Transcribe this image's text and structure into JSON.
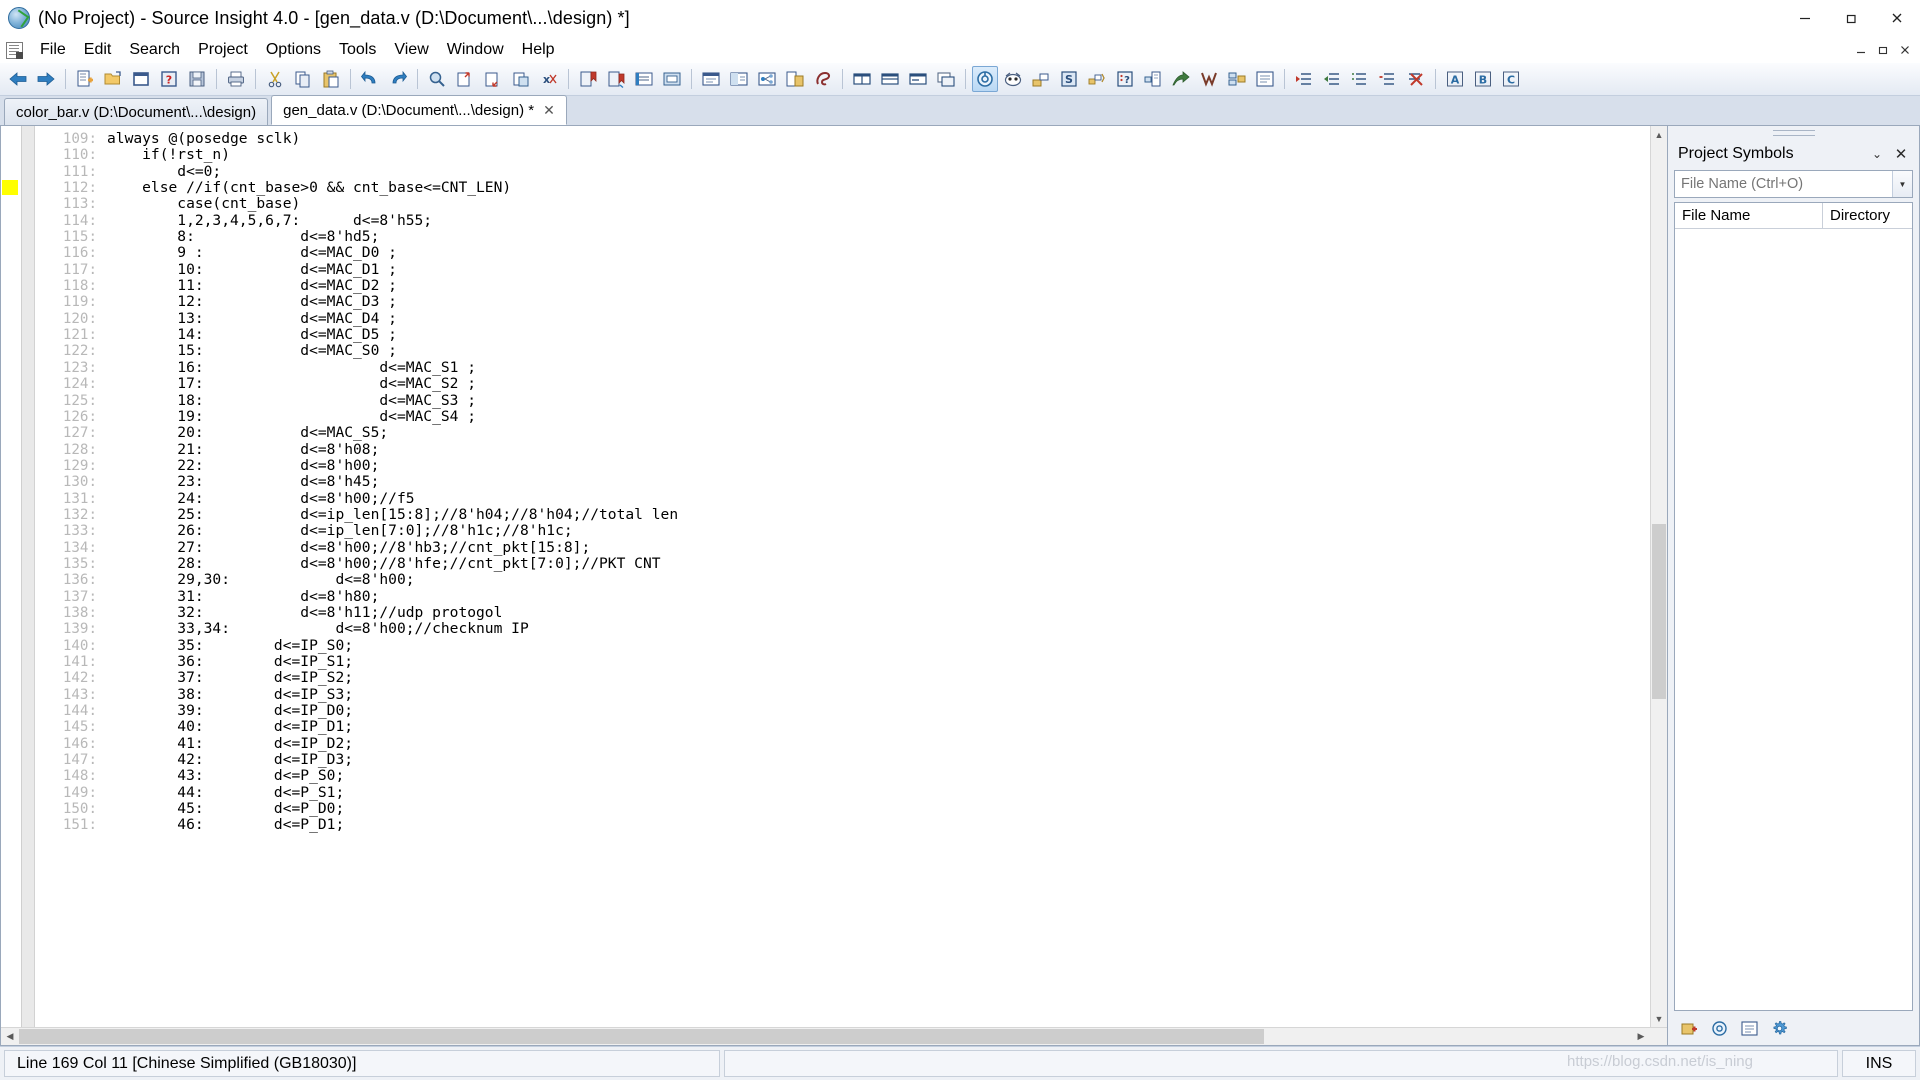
{
  "window": {
    "title": "(No Project) - Source Insight 4.0 - [gen_data.v (D:\\Document\\...\\design) *]",
    "app_icon": "source-insight-logo",
    "minimize": "─",
    "maximize": "❐",
    "close": "✕"
  },
  "menubar": {
    "doc_icon": "document-icon",
    "items": [
      {
        "label": "File"
      },
      {
        "label": "Edit"
      },
      {
        "label": "Search"
      },
      {
        "label": "Project"
      },
      {
        "label": "Options"
      },
      {
        "label": "Tools"
      },
      {
        "label": "View"
      },
      {
        "label": "Window"
      },
      {
        "label": "Help"
      }
    ],
    "mdi_minimize": "─",
    "mdi_restore": "❐",
    "mdi_close": "✕"
  },
  "toolbar": {
    "groups": [
      {
        "buttons": [
          {
            "name": "back-icon",
            "glyph": "back"
          },
          {
            "name": "forward-icon",
            "glyph": "forward"
          }
        ]
      },
      {
        "buttons": [
          {
            "name": "new-file-icon",
            "glyph": "newfile"
          },
          {
            "name": "open-file-icon",
            "glyph": "openfile"
          },
          {
            "name": "close-file-icon",
            "glyph": "closefile"
          },
          {
            "name": "file-properties-icon",
            "glyph": "fileprops"
          },
          {
            "name": "save-icon",
            "glyph": "save"
          }
        ]
      },
      {
        "buttons": [
          {
            "name": "print-icon",
            "glyph": "print"
          }
        ]
      },
      {
        "buttons": [
          {
            "name": "cut-icon",
            "glyph": "cut"
          },
          {
            "name": "copy-icon",
            "glyph": "copy"
          },
          {
            "name": "paste-icon",
            "glyph": "paste"
          }
        ]
      },
      {
        "buttons": [
          {
            "name": "undo-icon",
            "glyph": "undo"
          },
          {
            "name": "redo-icon",
            "glyph": "redo"
          }
        ]
      },
      {
        "buttons": [
          {
            "name": "search-icon",
            "glyph": "search"
          },
          {
            "name": "search-files-icon",
            "glyph": "searchfiles"
          },
          {
            "name": "search-backward-icon",
            "glyph": "searchback"
          },
          {
            "name": "replace-icon",
            "glyph": "replace"
          },
          {
            "name": "search-clear-icon",
            "glyph": "searchclear"
          }
        ]
      },
      {
        "buttons": [
          {
            "name": "bookmark-red-icon",
            "glyph": "bmred"
          },
          {
            "name": "bookmark-next-icon",
            "glyph": "bmnext"
          },
          {
            "name": "bookmark-list-icon",
            "glyph": "bmlist"
          },
          {
            "name": "bookmark-toggle-icon",
            "glyph": "bmtoggle"
          }
        ]
      },
      {
        "buttons": [
          {
            "name": "symbol-window-icon",
            "glyph": "symwin"
          },
          {
            "name": "context-window-icon",
            "glyph": "ctxwin"
          },
          {
            "name": "relation-window-icon",
            "glyph": "relwin"
          },
          {
            "name": "browse-project-icon",
            "glyph": "browseproj"
          },
          {
            "name": "reference-icon",
            "glyph": "refer"
          }
        ]
      },
      {
        "buttons": [
          {
            "name": "tile-horizontal-icon",
            "glyph": "tileh"
          },
          {
            "name": "tile-vertical-icon",
            "glyph": "tilev"
          },
          {
            "name": "split-window-icon",
            "glyph": "split"
          },
          {
            "name": "cascade-windows-icon",
            "glyph": "cascade"
          }
        ]
      },
      {
        "buttons": [
          {
            "name": "project-window-icon",
            "glyph": "projwin",
            "active": true
          },
          {
            "name": "symbol-browser-icon",
            "glyph": "symbrowser"
          },
          {
            "name": "add-project-file-icon",
            "glyph": "addproj"
          },
          {
            "name": "synchronize-files-icon",
            "glyph": "syncfiles"
          },
          {
            "name": "rebuild-project-icon",
            "glyph": "rebuild"
          },
          {
            "name": "project-report-icon",
            "glyph": "projreport"
          },
          {
            "name": "project-settings-icon",
            "glyph": "projsettings"
          },
          {
            "name": "project-import-icon",
            "glyph": "projimport"
          },
          {
            "name": "source-links-icon",
            "glyph": "srclinks"
          },
          {
            "name": "project-tree-icon",
            "glyph": "projtree"
          },
          {
            "name": "project-list-icon",
            "glyph": "projlist"
          }
        ]
      },
      {
        "buttons": [
          {
            "name": "indent-increase-icon",
            "glyph": "indentinc"
          },
          {
            "name": "indent-decrease-icon",
            "glyph": "indentdec"
          },
          {
            "name": "comment-block-icon",
            "glyph": "commentblk"
          },
          {
            "name": "uncomment-block-icon",
            "glyph": "uncomment"
          },
          {
            "name": "delete-block-icon",
            "glyph": "delblock"
          }
        ]
      },
      {
        "buttons": [
          {
            "name": "font-normal-icon",
            "glyph": "fontA"
          },
          {
            "name": "font-bold-icon",
            "glyph": "fontB"
          },
          {
            "name": "font-color-icon",
            "glyph": "fontC"
          }
        ]
      }
    ]
  },
  "tabs": [
    {
      "label": "color_bar.v (D:\\Document\\...\\design)",
      "selected": false,
      "closable": false
    },
    {
      "label": "gen_data.v (D:\\Document\\...\\design) *",
      "selected": true,
      "closable": true,
      "close_glyph": "✕"
    }
  ],
  "editor": {
    "bookmark_line": 112,
    "lines": [
      {
        "num": "109",
        "text": "always @(posedge sclk)"
      },
      {
        "num": "110",
        "text": "    if(!rst_n)"
      },
      {
        "num": "111",
        "text": "        d<=0;"
      },
      {
        "num": "112",
        "text": "    else //if(cnt_base>0 && cnt_base<=CNT_LEN)"
      },
      {
        "num": "113",
        "text": "        case(cnt_base)"
      },
      {
        "num": "114",
        "text": "        1,2,3,4,5,6,7:      d<=8'h55;"
      },
      {
        "num": "115",
        "text": "        8:            d<=8'hd5;"
      },
      {
        "num": "116",
        "text": "        9 :           d<=MAC_D0 ;"
      },
      {
        "num": "117",
        "text": "        10:           d<=MAC_D1 ;"
      },
      {
        "num": "118",
        "text": "        11:           d<=MAC_D2 ;"
      },
      {
        "num": "119",
        "text": "        12:           d<=MAC_D3 ;"
      },
      {
        "num": "120",
        "text": "        13:           d<=MAC_D4 ;"
      },
      {
        "num": "121",
        "text": "        14:           d<=MAC_D5 ;"
      },
      {
        "num": "122",
        "text": "        15:           d<=MAC_S0 ;"
      },
      {
        "num": "123",
        "text": "        16:                    d<=MAC_S1 ;"
      },
      {
        "num": "124",
        "text": "        17:                    d<=MAC_S2 ;"
      },
      {
        "num": "125",
        "text": "        18:                    d<=MAC_S3 ;"
      },
      {
        "num": "126",
        "text": "        19:                    d<=MAC_S4 ;"
      },
      {
        "num": "127",
        "text": "        20:           d<=MAC_S5;"
      },
      {
        "num": "128",
        "text": "        21:           d<=8'h08;"
      },
      {
        "num": "129",
        "text": "        22:           d<=8'h00;"
      },
      {
        "num": "130",
        "text": "        23:           d<=8'h45;"
      },
      {
        "num": "131",
        "text": "        24:           d<=8'h00;//f5"
      },
      {
        "num": "132",
        "text": "        25:           d<=ip_len[15:8];//8'h04;//8'h04;//total len"
      },
      {
        "num": "133",
        "text": "        26:           d<=ip_len[7:0];//8'h1c;//8'h1c;"
      },
      {
        "num": "134",
        "text": "        27:           d<=8'h00;//8'hb3;//cnt_pkt[15:8];"
      },
      {
        "num": "135",
        "text": "        28:           d<=8'h00;//8'hfe;//cnt_pkt[7:0];//PKT CNT"
      },
      {
        "num": "136",
        "text": "        29,30:            d<=8'h00;"
      },
      {
        "num": "137",
        "text": "        31:           d<=8'h80;"
      },
      {
        "num": "138",
        "text": "        32:           d<=8'h11;//udp protogol"
      },
      {
        "num": "139",
        "text": "        33,34:            d<=8'h00;//checknum IP"
      },
      {
        "num": "140",
        "text": "        35:        d<=IP_S0;"
      },
      {
        "num": "141",
        "text": "        36:        d<=IP_S1;"
      },
      {
        "num": "142",
        "text": "        37:        d<=IP_S2;"
      },
      {
        "num": "143",
        "text": "        38:        d<=IP_S3;"
      },
      {
        "num": "144",
        "text": "        39:        d<=IP_D0;"
      },
      {
        "num": "145",
        "text": "        40:        d<=IP_D1;"
      },
      {
        "num": "146",
        "text": "        41:        d<=IP_D2;"
      },
      {
        "num": "147",
        "text": "        42:        d<=IP_D3;"
      },
      {
        "num": "148",
        "text": "        43:        d<=P_S0;"
      },
      {
        "num": "149",
        "text": "        44:        d<=P_S1;"
      },
      {
        "num": "150",
        "text": "        45:        d<=P_D0;"
      },
      {
        "num": "151",
        "text": "        46:        d<=P_D1;"
      }
    ],
    "scroll_up_glyph": "▲",
    "scroll_down_glyph": "▼",
    "scroll_left_glyph": "◀",
    "scroll_right_glyph": "▶"
  },
  "panel": {
    "title": "Project Symbols",
    "dropdown_glyph": "⌄",
    "close_glyph": "✕",
    "search": {
      "placeholder": "File Name (Ctrl+O)",
      "value": "",
      "arrow_glyph": "▼"
    },
    "columns": [
      {
        "label": "File Name"
      },
      {
        "label": "Directory"
      }
    ],
    "rows": [],
    "footer_buttons": [
      {
        "name": "add-file-icon",
        "glyph": "addfile"
      },
      {
        "name": "sync-files-icon",
        "glyph": "syncfile"
      },
      {
        "name": "file-list-icon",
        "glyph": "filelist"
      },
      {
        "name": "settings-gear-icon",
        "glyph": "gear"
      }
    ]
  },
  "statusbar": {
    "position": "Line 169  Col 11   [Chinese Simplified (GB18030)]",
    "insert_mode": "INS",
    "watermark": "https://blog.csdn.net/is_ning"
  }
}
